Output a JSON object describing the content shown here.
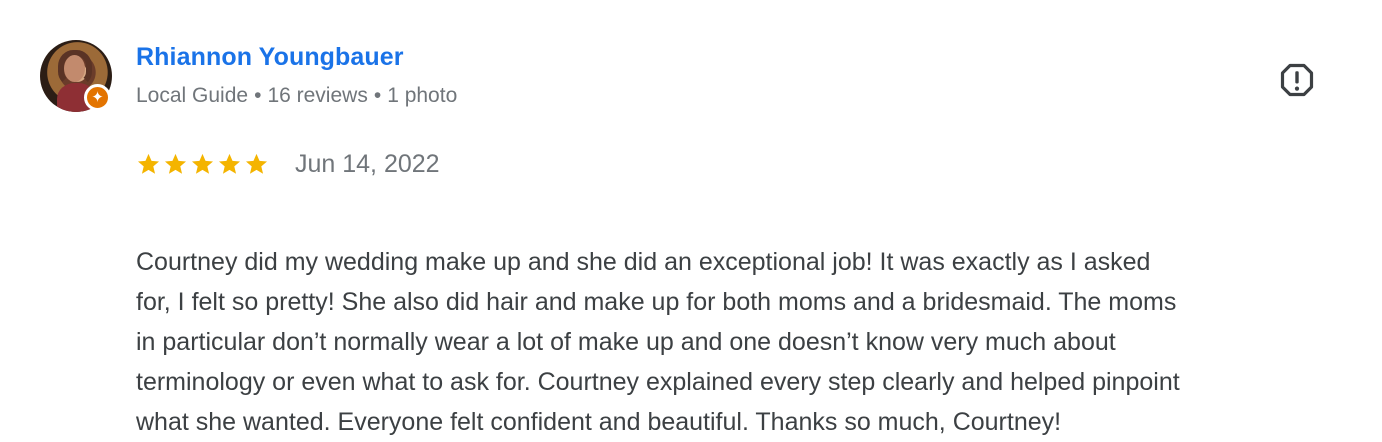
{
  "review": {
    "reviewer": {
      "name": "Rhiannon Youngbauer",
      "guide_label": "Local Guide",
      "meta_separator": "•",
      "reviews_count": "16 reviews",
      "photo_count": "1 photo",
      "avatar": "reviewer-avatar",
      "badge_icon": "local-guide-badge-icon"
    },
    "rating": {
      "value": 5,
      "max": 5,
      "icon": "star-icon",
      "color": "#f4b400"
    },
    "date": "Jun 14, 2022",
    "text_lines": [
      "Courtney did my wedding make up and she did an exceptional job! It was exactly as I asked",
      "for, I felt so pretty! She also did hair and make up for both moms and a bridesmaid. The moms",
      "in particular don’t normally wear a lot of make up and one doesn’t know very much about",
      "terminology or even what to ask for. Courtney explained every step clearly and helped pinpoint",
      "what she wanted. Everyone felt confident and beautiful. Thanks so much, Courtney!"
    ],
    "actions": {
      "report_icon": "report-icon"
    },
    "colors": {
      "name": "#1a73e8",
      "meta": "#70757a",
      "body": "#3c4043",
      "badge": "#e37400"
    }
  }
}
